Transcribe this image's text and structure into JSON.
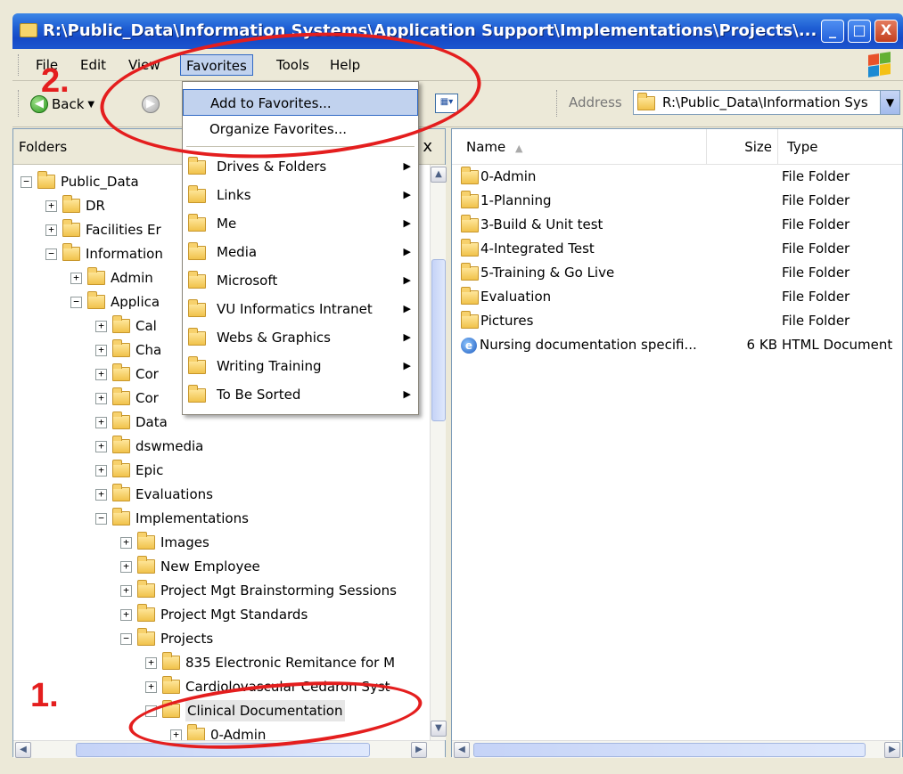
{
  "window": {
    "title": "R:\\Public_Data\\Information Systems\\Application Support\\Implementations\\Projects\\...",
    "minimize": "_",
    "maximize": "□",
    "close": "X"
  },
  "menubar": [
    "File",
    "Edit",
    "View",
    "Favorites",
    "Tools",
    "Help"
  ],
  "toolbar": {
    "back_label": "Back",
    "address_label": "Address",
    "address_value": "R:\\Public_Data\\Information Sys"
  },
  "favorites_menu": {
    "top_items": [
      "Add to Favorites...",
      "Organize Favorites..."
    ],
    "folders": [
      "Drives & Folders",
      "Links",
      "Me",
      "Media",
      "Microsoft",
      "VU Informatics Intranet",
      "Webs & Graphics",
      "Writing Training",
      "To Be Sorted"
    ]
  },
  "folders_pane": {
    "header": "Folders",
    "close": "x",
    "tree": [
      {
        "label": "Public_Data",
        "expander": "−"
      },
      {
        "label": "DR",
        "expander": "+"
      },
      {
        "label": "Facilities Er",
        "expander": "+"
      },
      {
        "label": "Information",
        "expander": "−"
      },
      {
        "label": "Admin",
        "expander": "+"
      },
      {
        "label": "Applica",
        "expander": "−"
      },
      {
        "label": "Cal",
        "expander": "+"
      },
      {
        "label": "Cha",
        "expander": "+"
      },
      {
        "label": "Cor",
        "expander": "+"
      },
      {
        "label": "Cor",
        "expander": "+"
      },
      {
        "label": "Data",
        "expander": "+"
      },
      {
        "label": "dswmedia",
        "expander": "+"
      },
      {
        "label": "Epic",
        "expander": "+"
      },
      {
        "label": "Evaluations",
        "expander": "+"
      },
      {
        "label": "Implementations",
        "expander": "−"
      },
      {
        "label": "Images",
        "expander": "+"
      },
      {
        "label": "New Employee",
        "expander": "+"
      },
      {
        "label": "Project Mgt Brainstorming Sessions",
        "expander": "+"
      },
      {
        "label": "Project Mgt Standards",
        "expander": "+"
      },
      {
        "label": "Projects",
        "expander": "−"
      },
      {
        "label": "835 Electronic Remitance for M",
        "expander": "+"
      },
      {
        "label": "Cardiolovascular Cedaron Syst",
        "expander": "+"
      },
      {
        "label": "Clinical Documentation",
        "expander": "−"
      },
      {
        "label": "0-Admin",
        "expander": "+"
      }
    ]
  },
  "file_list": {
    "columns": {
      "name": "Name",
      "size": "Size",
      "type": "Type"
    },
    "rows": [
      {
        "name": "0-Admin",
        "size": "",
        "type": "File Folder",
        "icon": "folder-icon"
      },
      {
        "name": "1-Planning",
        "size": "",
        "type": "File Folder",
        "icon": "folder-icon"
      },
      {
        "name": "3-Build & Unit test",
        "size": "",
        "type": "File Folder",
        "icon": "folder-icon"
      },
      {
        "name": "4-Integrated Test",
        "size": "",
        "type": "File Folder",
        "icon": "folder-icon"
      },
      {
        "name": "5-Training & Go Live",
        "size": "",
        "type": "File Folder",
        "icon": "folder-icon"
      },
      {
        "name": "Evaluation",
        "size": "",
        "type": "File Folder",
        "icon": "folder-icon"
      },
      {
        "name": "Pictures",
        "size": "",
        "type": "File Folder",
        "icon": "folder-icon"
      },
      {
        "name": "Nursing documentation specifi...",
        "size": "6 KB",
        "type": "HTML Document",
        "icon": "ie-icon"
      }
    ]
  },
  "annotations": {
    "step1": "1.",
    "step2": "2."
  },
  "colors": {
    "annotation": "#e41e1e",
    "title_bar": "#1f5fd4",
    "menu_highlight": "#c1d2ee"
  }
}
